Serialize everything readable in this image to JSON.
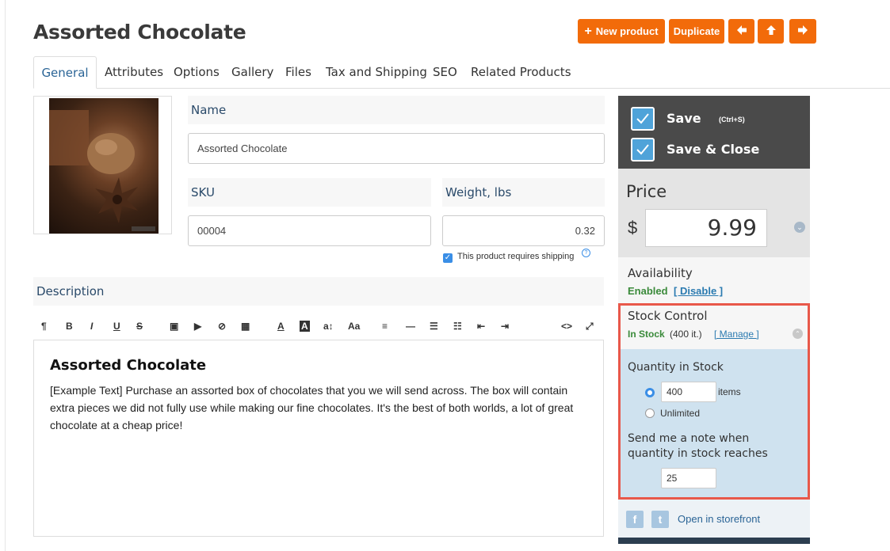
{
  "product": {
    "title": "Assorted Chocolate"
  },
  "toolbar": {
    "new_product": "New product",
    "new_product_icon": "+",
    "duplicate": "Duplicate",
    "prev_icon": "🡄",
    "up_icon": "🡅",
    "next_icon": "🡆"
  },
  "tabs": [
    "General",
    "Attributes",
    "Options",
    "Gallery",
    "Files",
    "Tax and Shipping",
    "SEO",
    "Related Products"
  ],
  "fields": {
    "name_label": "Name",
    "name_value": "Assorted Chocolate",
    "sku_label": "SKU",
    "sku_value": "00004",
    "weight_label": "Weight, lbs",
    "weight_value": "0.32",
    "shipping_label": "This product requires shipping",
    "shipping_help": "?",
    "description_label": "Description"
  },
  "editor_toolbar": [
    "¶",
    "B",
    "I",
    "U",
    "S",
    "▣",
    "▶",
    "⊘",
    "▦",
    "A",
    "A",
    "a↕",
    "Aa",
    "≡",
    "—",
    "☰",
    "☷",
    "⇤",
    "⇥",
    "<>",
    "⤢"
  ],
  "description": {
    "heading": "Assorted Chocolate",
    "body": "[Example Text] Purchase an assorted box of chocolates that you we will send across. The box will contain extra pieces we did not fully use while making our fine chocolates. It's the best of both worlds, a lot of great chocolate at a cheap price!"
  },
  "save": {
    "save_label": "Save",
    "shortcut": "(Ctrl+S)",
    "save_close_label": "Save & Close"
  },
  "price": {
    "label": "Price",
    "currency": "$",
    "value": "9.99"
  },
  "availability": {
    "label": "Availability",
    "status": "Enabled",
    "action": "[ Disable ]"
  },
  "stock": {
    "label": "Stock Control",
    "status": "In Stock",
    "count": "(400 it.)",
    "manage": "[ Manage ]",
    "qty_label": "Quantity in Stock",
    "qty_value": "400",
    "qty_unit": "items",
    "unlimited_label": "Unlimited",
    "note_label": "Send me a note when quantity in stock reaches",
    "note_value": "25"
  },
  "footer": {
    "open_storefront": "Open in storefront",
    "facebook": "f",
    "twitter": "t"
  },
  "colors": {
    "accent": "#f26b0a",
    "highlight": "#e8584a",
    "enabled": "#3a8a3a"
  }
}
